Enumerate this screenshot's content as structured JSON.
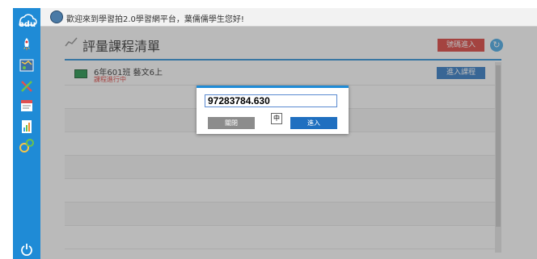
{
  "sidebar": {
    "logo_text": "edu",
    "items": [
      {
        "icon": "rocket-icon"
      },
      {
        "icon": "map-icon"
      },
      {
        "icon": "tools-icon"
      },
      {
        "icon": "exam-icon"
      },
      {
        "icon": "report-icon"
      },
      {
        "icon": "gears-icon"
      }
    ],
    "power_icon": "power-icon"
  },
  "topbar": {
    "welcome": "歡迎來到學習拍2.0學習網平台，葉儒儒學生您好!"
  },
  "page": {
    "title": "評量課程清單",
    "code_enter_label": "號碼進入",
    "refresh_icon": "refresh-icon"
  },
  "courses": [
    {
      "name": "6年601班 藝文6上",
      "status": "課程進行中",
      "enter_label": "進入課程"
    }
  ],
  "modal": {
    "input_value": "97283784.630",
    "close_label": "關閉",
    "ime_label": "中",
    "enter_label": "進入"
  },
  "colors": {
    "sidebar": "#1f8bd6",
    "accent_red": "#d9322e",
    "accent_blue": "#1f6fc0"
  }
}
